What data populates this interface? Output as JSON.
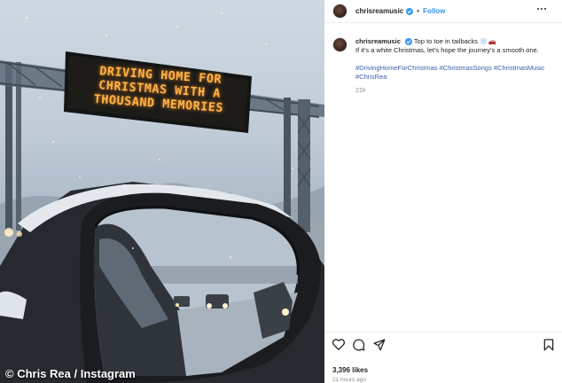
{
  "photo": {
    "sign_lines": [
      "DRIVING HOME FOR",
      "CHRISTMAS WITH A",
      "THOUSAND MEMORIES"
    ],
    "credit": "© Chris Rea / Instagram"
  },
  "header": {
    "username": "chrisreamusic",
    "separator": "•",
    "follow_label": "Follow"
  },
  "caption": {
    "username": "chrisreamusic",
    "line1": "Top to toe in tailbacks ❄️🚗",
    "line2": "If it's a white Christmas, let's hope the journey's a smooth one.",
    "hashtags": [
      "#DrivingHomeForChristmas",
      "#ChristmasSongs",
      "#ChristmasMusic",
      "#ChrisRea"
    ],
    "timestamp": "21h"
  },
  "actions": {
    "icons": [
      "heart-icon",
      "comment-icon",
      "share-icon",
      "bookmark-icon"
    ],
    "likes": "3,396 likes",
    "posted": "21 hours ago"
  },
  "colors": {
    "link": "#3a5ea8",
    "follow": "#3897f0",
    "sign": "#ffb347"
  }
}
